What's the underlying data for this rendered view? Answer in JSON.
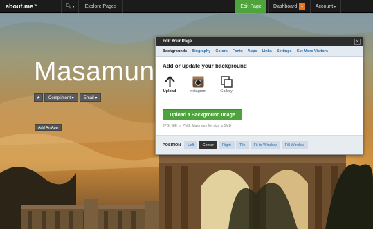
{
  "topbar": {
    "logo": "about.me",
    "explore": "Explore Pages",
    "edit_page": "Edit Page",
    "dashboard": "Dashboard",
    "dashboard_count": "1",
    "account": "Account"
  },
  "profile": {
    "name": "Masamun",
    "compliment": "Compliment",
    "email": "Email",
    "add_app": "Add An App"
  },
  "panel": {
    "title": "Edit Your Page",
    "tabs": [
      "Backgrounds",
      "Biography",
      "Colors",
      "Fonts",
      "Apps",
      "Links",
      "Settings",
      "Get More Visitors"
    ],
    "active_tab": "Backgrounds",
    "section_title": "Add or update your background",
    "options": [
      {
        "label": "Upload",
        "icon": "upload-arrow-icon"
      },
      {
        "label": "Instagram",
        "icon": "instagram-icon"
      },
      {
        "label": "Gallery",
        "icon": "gallery-icon"
      }
    ],
    "upload_button": "Upload a Background Image",
    "hint": "JPG, GIF, or PNG. Maximum file size is 5MB",
    "position_label": "POSITION",
    "positions": [
      "Left",
      "Center",
      "Right",
      "Tile",
      "Fit to Window",
      "Fill Window"
    ],
    "active_position": "Center"
  },
  "colors": {
    "accent_green": "#4ea33c",
    "badge_orange": "#e8751c",
    "topbar_bg": "#1b1b1b"
  }
}
